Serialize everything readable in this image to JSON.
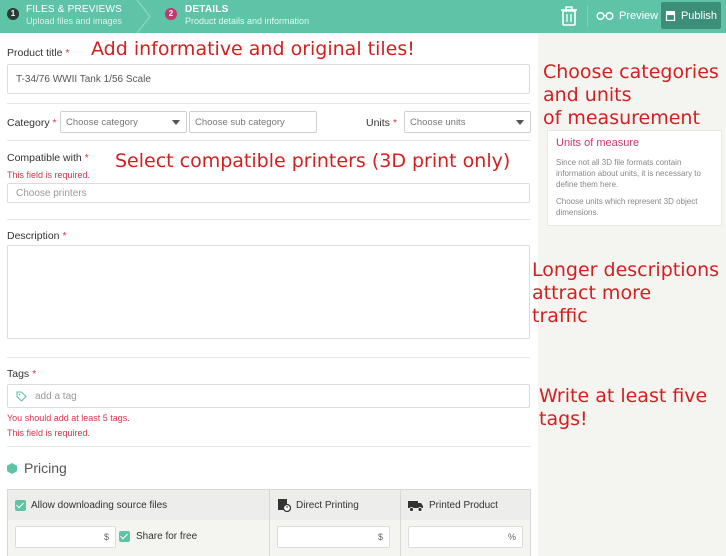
{
  "header": {
    "step1": {
      "num": "1",
      "title": "FILES & PREVIEWS",
      "subtitle": "Upload files and images"
    },
    "step2": {
      "num": "2",
      "title": "DETAILS",
      "subtitle": "Product details and information"
    },
    "preview_label": "Preview",
    "publish_label": "Publish",
    "accent_color": "#5fc3a8",
    "publish_color": "#3d8e78"
  },
  "form": {
    "product_title": {
      "label": "Product title",
      "required": "*",
      "value": "T-34/76 WWII Tank 1/56 Scale"
    },
    "category": {
      "label": "Category",
      "required": "*",
      "placeholder": "Choose category",
      "sub_placeholder": "Choose sub category"
    },
    "units": {
      "label": "Units",
      "required": "*",
      "placeholder": "Choose units"
    },
    "compatible": {
      "label": "Compatible with",
      "required": "*",
      "error": "This field is required.",
      "placeholder": "Choose printers"
    },
    "description": {
      "label": "Description",
      "required": "*"
    },
    "tags": {
      "label": "Tags",
      "required": "*",
      "placeholder": "add a tag",
      "error1": "You should add at least 5 tags.",
      "error2": "This field is required."
    },
    "pricing": {
      "title": "Pricing",
      "allow_download": "Allow downloading source files",
      "direct_printing": "Direct Printing",
      "printed_product": "Printed Product",
      "share_for_free": "Share for free",
      "currency": "$",
      "percent": "%"
    }
  },
  "infobox": {
    "title": "Units of measure",
    "p1": "Since not all 3D file formats contain information about units, it is necessary to define them here.",
    "p2": "Choose units which represent 3D object dimensions."
  },
  "annotations": {
    "a1": "Add informative and original tiles!",
    "a2_l1": "Choose categories",
    "a2_l2": "and units",
    "a2_l3": "of measurement",
    "a3": "Select compatible printers (3D print only)",
    "a4_l1": "Longer descriptions",
    "a4_l2": "attract more",
    "a4_l3": "traffic",
    "a5_l1": "Write at least five",
    "a5_l2": "tags!"
  }
}
